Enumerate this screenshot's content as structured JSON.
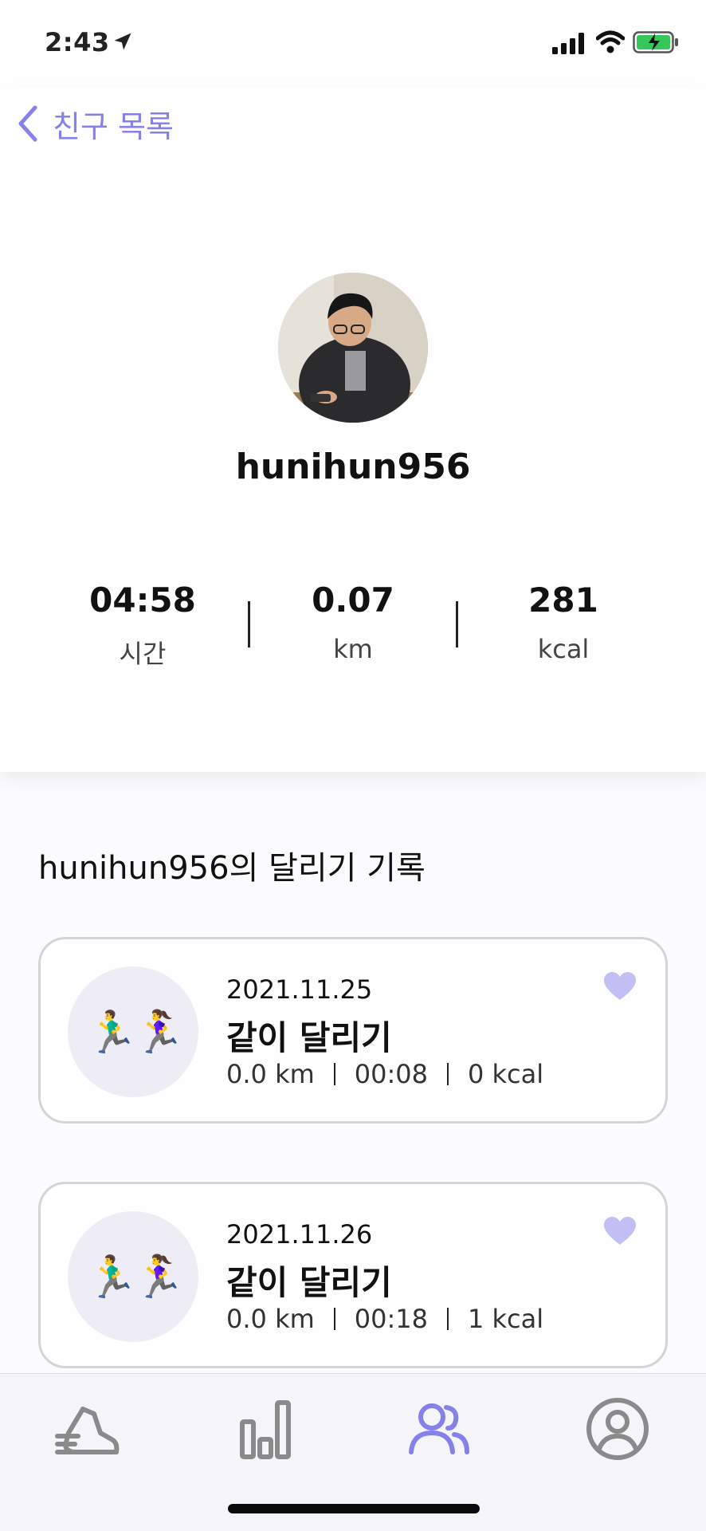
{
  "status_bar": {
    "time": "2:43"
  },
  "nav": {
    "back_label": "친구 목록"
  },
  "profile": {
    "username": "hunihun956"
  },
  "stats": [
    {
      "value": "04:58",
      "unit": "시간"
    },
    {
      "value": "0.07",
      "unit": "km"
    },
    {
      "value": "281",
      "unit": "kcal"
    }
  ],
  "records_section": {
    "title": "hunihun956의 달리기 기록"
  },
  "records": [
    {
      "emoji": "🏃‍♂️🏃‍♀️",
      "date": "2021.11.25",
      "title": "같이 달리기",
      "distance": "0.0 km",
      "duration": "00:08",
      "calories": "0 kcal"
    },
    {
      "emoji": "🏃‍♂️🏃‍♀️",
      "date": "2021.11.26",
      "title": "같이 달리기",
      "distance": "0.0 km",
      "duration": "00:18",
      "calories": "1 kcal"
    }
  ],
  "tab_bar": {
    "tabs": [
      {
        "icon": "running-shoe-icon"
      },
      {
        "icon": "bar-chart-icon"
      },
      {
        "icon": "friends-icon",
        "active": true
      },
      {
        "icon": "profile-icon"
      }
    ]
  },
  "colors": {
    "accent": "#8580ea",
    "heart": "#c2bff5",
    "inactive_icon": "#8a8a8a",
    "card_border": "#d4d3d8"
  }
}
